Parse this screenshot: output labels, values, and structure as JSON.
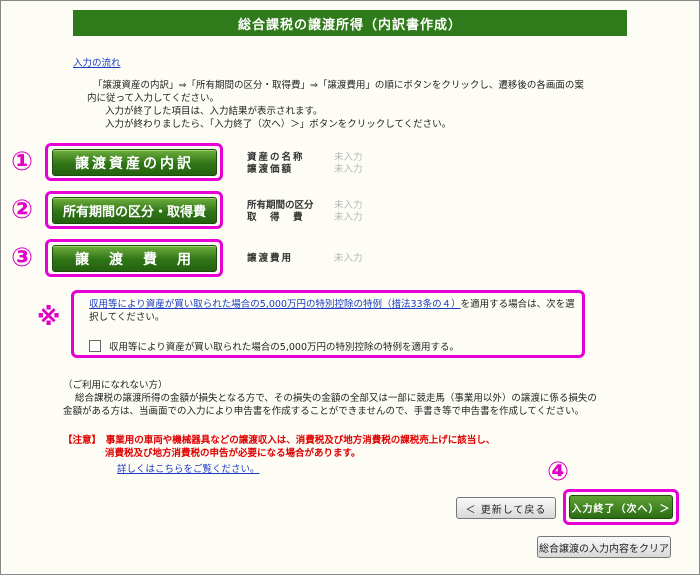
{
  "title": "総合課税の譲渡所得（内訳書作成）",
  "flow_link": "入力の流れ",
  "intro": [
    "「譲渡資産の内訳」⇒「所有期間の区分・取得費」⇒「譲渡費用」の順にボタンをクリックし、遷移後の各画面の案",
    "内に従って入力してください。",
    "入力が終了した項目は、入力結果が表示されます。",
    "入力が終わりましたら、「入力終了（次へ）＞」ボタンをクリックしてください。"
  ],
  "markers": {
    "one": "①",
    "two": "②",
    "three": "③",
    "four": "④",
    "kome": "※"
  },
  "sections": [
    {
      "button": "譲渡資産の内訳",
      "labels": [
        "資産の名称",
        "譲渡価額"
      ],
      "values": [
        "未入力",
        "未入力"
      ]
    },
    {
      "button": "所有期間の区分・取得費",
      "labels": [
        "所有期間の区分",
        "取　得　費"
      ],
      "values": [
        "未入力",
        "未入力"
      ]
    },
    {
      "button": "譲　渡　費　用",
      "labels": [
        "譲渡費用"
      ],
      "values": [
        "未入力"
      ]
    }
  ],
  "special": {
    "link": "収用等により資産が買い取られた場合の5,000万円の特別控除の特例（措法33条の４）",
    "text_after": "を適用する場合は、次を選択してください。",
    "checkbox_label": "収用等により資産が買い取られた場合の5,000万円の特別控除の特例を適用する。"
  },
  "not_usable": {
    "heading": "（ご利用になれない方）",
    "body": "総合課税の譲渡所得の金額が損失となる方で、その損失の金額の全部又は一部に競走馬（事業用以外）の譲渡に係る損失の金額がある方は、当画面での入力により申告書を作成することができませんので、手書き等で申告書を作成してください。"
  },
  "note": {
    "tag": "【注意】",
    "line1": "事業用の車両や機械器具などの譲渡収入は、消費税及び地方消費税の課税売上げに該当し、",
    "line2": "消費税及び地方消費税の申告が必要になる場合があります。",
    "link": "詳しくはこちらをご覧ください。"
  },
  "buttons": {
    "back": "＜ 更新して戻る",
    "next": "入力終了（次へ）＞",
    "clear": "総合譲渡の入力内容をクリア"
  },
  "colors": {
    "accent_green": "#2f7a1a",
    "highlight_magenta": "#e600d6",
    "warning_red": "#e00000",
    "link_blue": "#1a3bc4"
  }
}
